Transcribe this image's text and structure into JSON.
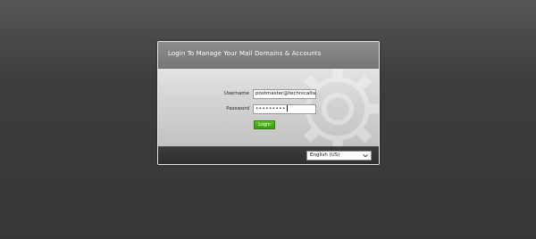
{
  "login": {
    "title": "Login To Manage Your Mail Domains & Accounts",
    "username_label": "Username",
    "username_value": "postmaster@technicalta",
    "password_label": "Password",
    "password_value": "•••••••••",
    "login_button": "Login"
  },
  "footer": {
    "language_selected": "English (US)"
  },
  "icons": {
    "watermark": "gear-icon",
    "dropdown": "chevron-down-icon"
  },
  "colors": {
    "login_button": "#48b016",
    "header": "#858585",
    "footer": "#353535"
  }
}
